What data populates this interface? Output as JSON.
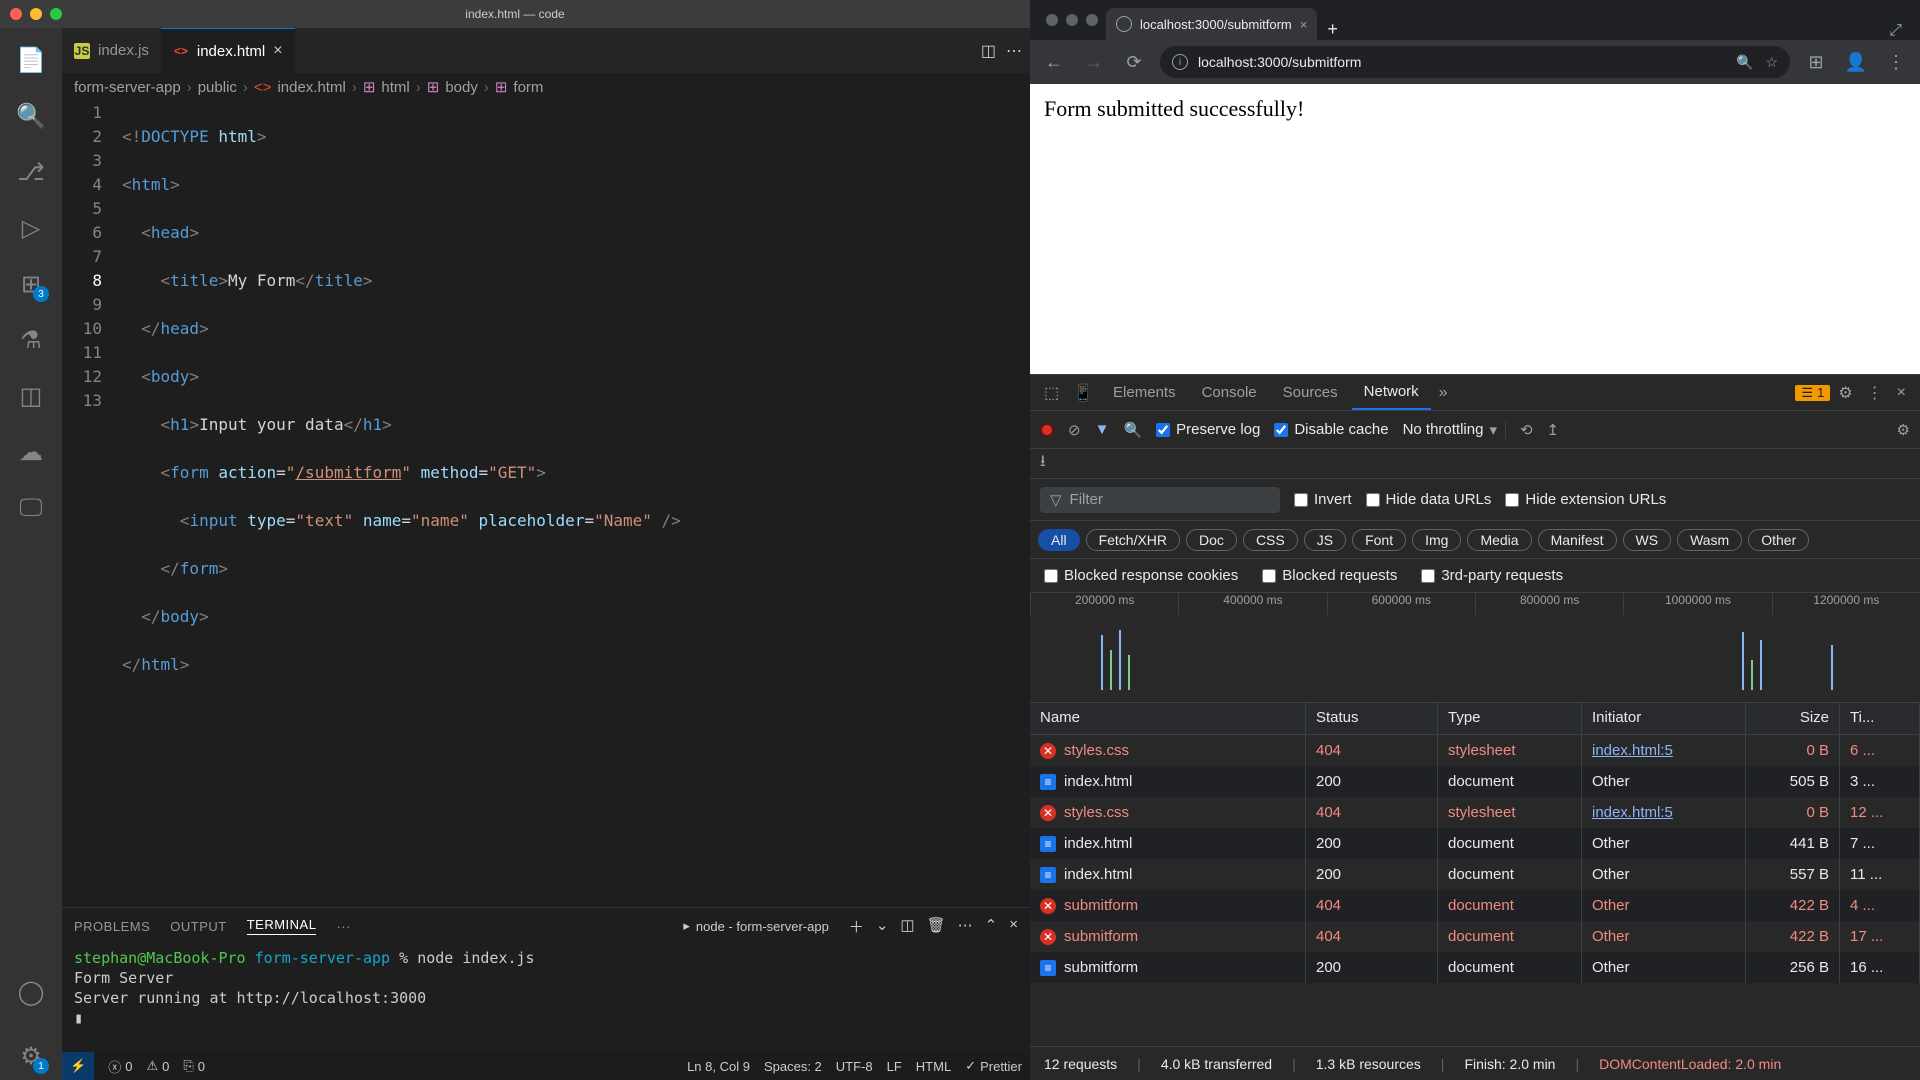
{
  "vscode": {
    "title": "index.html — code",
    "tabs": [
      {
        "label": "index.js",
        "icon": "JS",
        "active": false
      },
      {
        "label": "index.html",
        "icon": "<>",
        "active": true
      }
    ],
    "breadcrumbs": [
      "form-server-app",
      "public",
      "index.html",
      "html",
      "body",
      "form"
    ],
    "source_control_badge": "3",
    "settings_badge": "1",
    "code": {
      "lines": [
        "1",
        "2",
        "3",
        "4",
        "5",
        "6",
        "7",
        "8",
        "9",
        "10",
        "11",
        "12",
        "13"
      ]
    },
    "panel": {
      "tabs": [
        "PROBLEMS",
        "OUTPUT",
        "TERMINAL",
        "···"
      ],
      "terminal_select": "node - form-server-app",
      "prompt_user": "stephan@MacBook-Pro",
      "prompt_path": "form-server-app",
      "prompt_cmd": "node index.js",
      "out1": "Form Server",
      "out2": "Server running at http://localhost:3000"
    },
    "status": {
      "errors": "0",
      "warnings": "0",
      "ports": "0",
      "cursor": "Ln 8, Col 9",
      "spaces": "Spaces: 2",
      "encoding": "UTF-8",
      "eol": "LF",
      "lang": "HTML",
      "prettier": "Prettier"
    }
  },
  "chrome": {
    "tab_title": "localhost:3000/submitform",
    "url": "localhost:3000/submitform",
    "page_text": "Form submitted successfully!",
    "devtools": {
      "tabs": [
        "Elements",
        "Console",
        "Sources",
        "Network"
      ],
      "active_tab": "Network",
      "issue_count": "1",
      "preserve_log": "Preserve log",
      "disable_cache": "Disable cache",
      "throttling": "No throttling",
      "filter_placeholder": "Filter",
      "filter_opts": [
        "Invert",
        "Hide data URLs",
        "Hide extension URLs"
      ],
      "types": [
        "All",
        "Fetch/XHR",
        "Doc",
        "CSS",
        "JS",
        "Font",
        "Img",
        "Media",
        "Manifest",
        "WS",
        "Wasm",
        "Other"
      ],
      "checks": [
        "Blocked response cookies",
        "Blocked requests",
        "3rd-party requests"
      ],
      "timeline_ticks": [
        "200000 ms",
        "400000 ms",
        "600000 ms",
        "800000 ms",
        "1000000 ms",
        "1200000 ms"
      ],
      "columns": [
        "Name",
        "Status",
        "Type",
        "Initiator",
        "Size",
        "Ti..."
      ],
      "rows": [
        {
          "name": "styles.css",
          "status": "404",
          "type": "stylesheet",
          "initiator": "index.html:5",
          "size": "0 B",
          "time": "6 ...",
          "err": true,
          "link": true
        },
        {
          "name": "index.html",
          "status": "200",
          "type": "document",
          "initiator": "Other",
          "size": "505 B",
          "time": "3 ...",
          "err": false
        },
        {
          "name": "styles.css",
          "status": "404",
          "type": "stylesheet",
          "initiator": "index.html:5",
          "size": "0 B",
          "time": "12 ...",
          "err": true,
          "link": true
        },
        {
          "name": "index.html",
          "status": "200",
          "type": "document",
          "initiator": "Other",
          "size": "441 B",
          "time": "7 ...",
          "err": false
        },
        {
          "name": "index.html",
          "status": "200",
          "type": "document",
          "initiator": "Other",
          "size": "557 B",
          "time": "11 ...",
          "err": false
        },
        {
          "name": "submitform",
          "status": "404",
          "type": "document",
          "initiator": "Other",
          "size": "422 B",
          "time": "4 ...",
          "err": true
        },
        {
          "name": "submitform",
          "status": "404",
          "type": "document",
          "initiator": "Other",
          "size": "422 B",
          "time": "17 ...",
          "err": true
        },
        {
          "name": "submitform",
          "status": "200",
          "type": "document",
          "initiator": "Other",
          "size": "256 B",
          "time": "16 ...",
          "err": false
        }
      ],
      "summary": {
        "requests": "12 requests",
        "transferred": "4.0 kB transferred",
        "resources": "1.3 kB resources",
        "finish": "Finish: 2.0 min",
        "dcl": "DOMContentLoaded: 2.0 min"
      }
    }
  }
}
